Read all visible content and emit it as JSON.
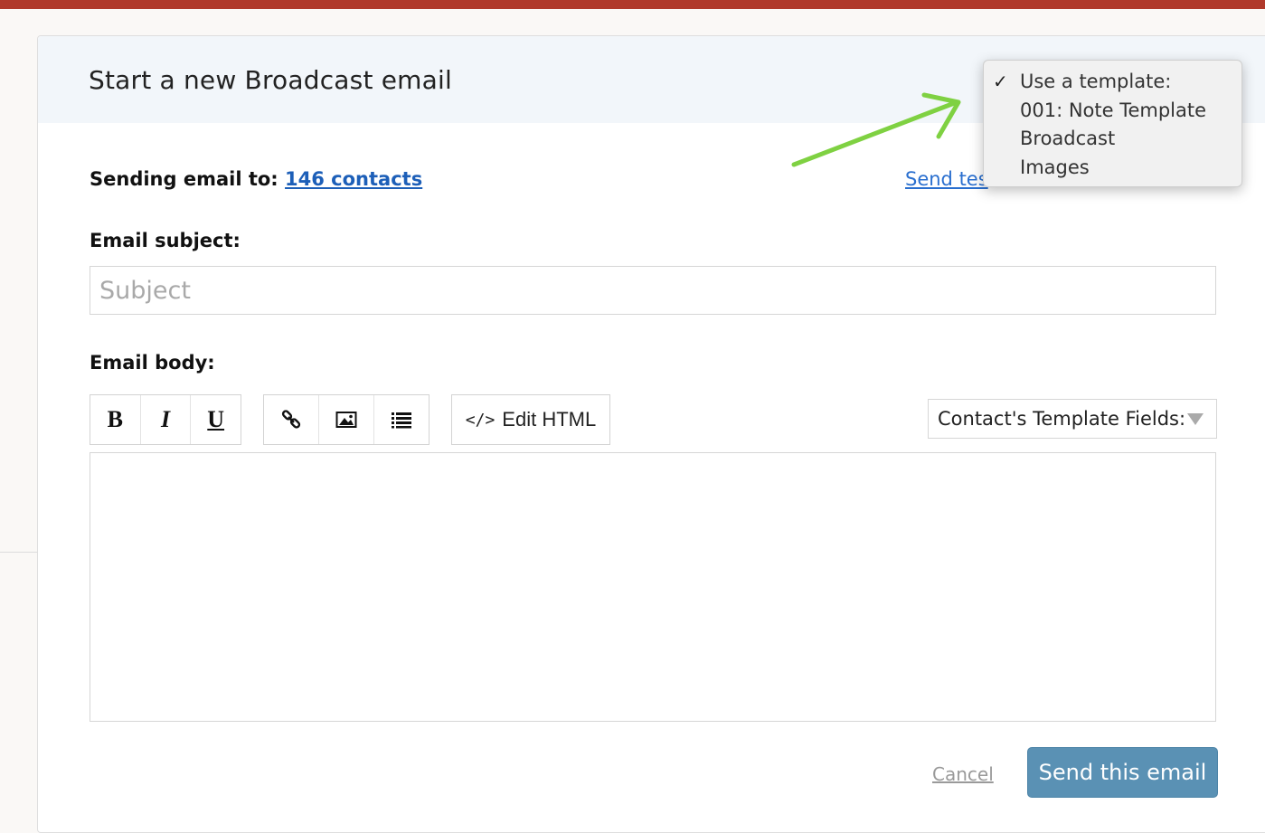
{
  "header": {
    "title": "Start a new Broadcast email"
  },
  "recipients": {
    "label": "Sending email to:",
    "link_text": "146 contacts"
  },
  "send_test_link": "Send tes",
  "subject": {
    "label": "Email subject:",
    "placeholder": "Subject",
    "value": ""
  },
  "body": {
    "label": "Email body:"
  },
  "toolbar": {
    "bold": "B",
    "italic": "I",
    "underline": "U",
    "link_icon": "link-icon",
    "image_icon": "image-icon",
    "list_icon": "list-icon",
    "edit_html_icon": "</>",
    "edit_html_label": "Edit HTML",
    "fields_label": "Contact's Template Fields:"
  },
  "template_dropdown": {
    "items": [
      {
        "label": "Use a template:",
        "checked": true
      },
      {
        "label": "001: Note Template",
        "checked": false
      },
      {
        "label": "Broadcast",
        "checked": false
      },
      {
        "label": "Images",
        "checked": false
      }
    ],
    "check_mark": "✓"
  },
  "footer": {
    "cancel_label": "Cancel",
    "send_label": "Send this email"
  },
  "colors": {
    "top_bar": "#b0392b",
    "link": "#1d5fb8",
    "send_button": "#5a91b4",
    "arrow": "#7fd142"
  }
}
